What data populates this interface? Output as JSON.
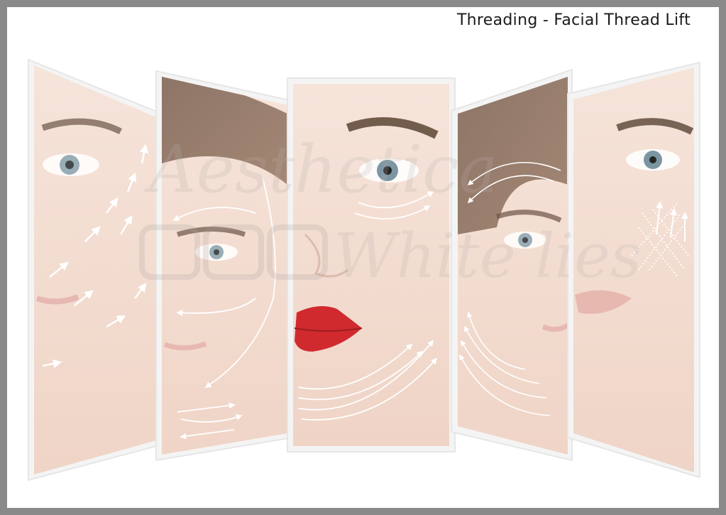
{
  "page": {
    "title": "Threading - Facial Thread Lift"
  },
  "colors": {
    "border": "#8a8a8a",
    "background": "#ffffff",
    "skin_light": "#f3ddd3",
    "skin_shadow": "#e6c7b8",
    "hair": "#5c4636",
    "lips_red": "#d02a2e",
    "lips_nude": "#e4b1aa",
    "arrow": "#ffffff",
    "panel_border": "#e6e6e6"
  },
  "panels": [
    {
      "id": "panel-1",
      "icon": "face-panel-icon"
    },
    {
      "id": "panel-2",
      "icon": "face-panel-icon"
    },
    {
      "id": "panel-3",
      "icon": "face-panel-icon"
    },
    {
      "id": "panel-4",
      "icon": "face-panel-icon"
    },
    {
      "id": "panel-5",
      "icon": "face-panel-icon"
    }
  ],
  "watermark": {
    "line1": "Aesthetica",
    "line2": "White lies",
    "icons": [
      "camera-icon",
      "dna-icon",
      "chat-icon"
    ]
  }
}
